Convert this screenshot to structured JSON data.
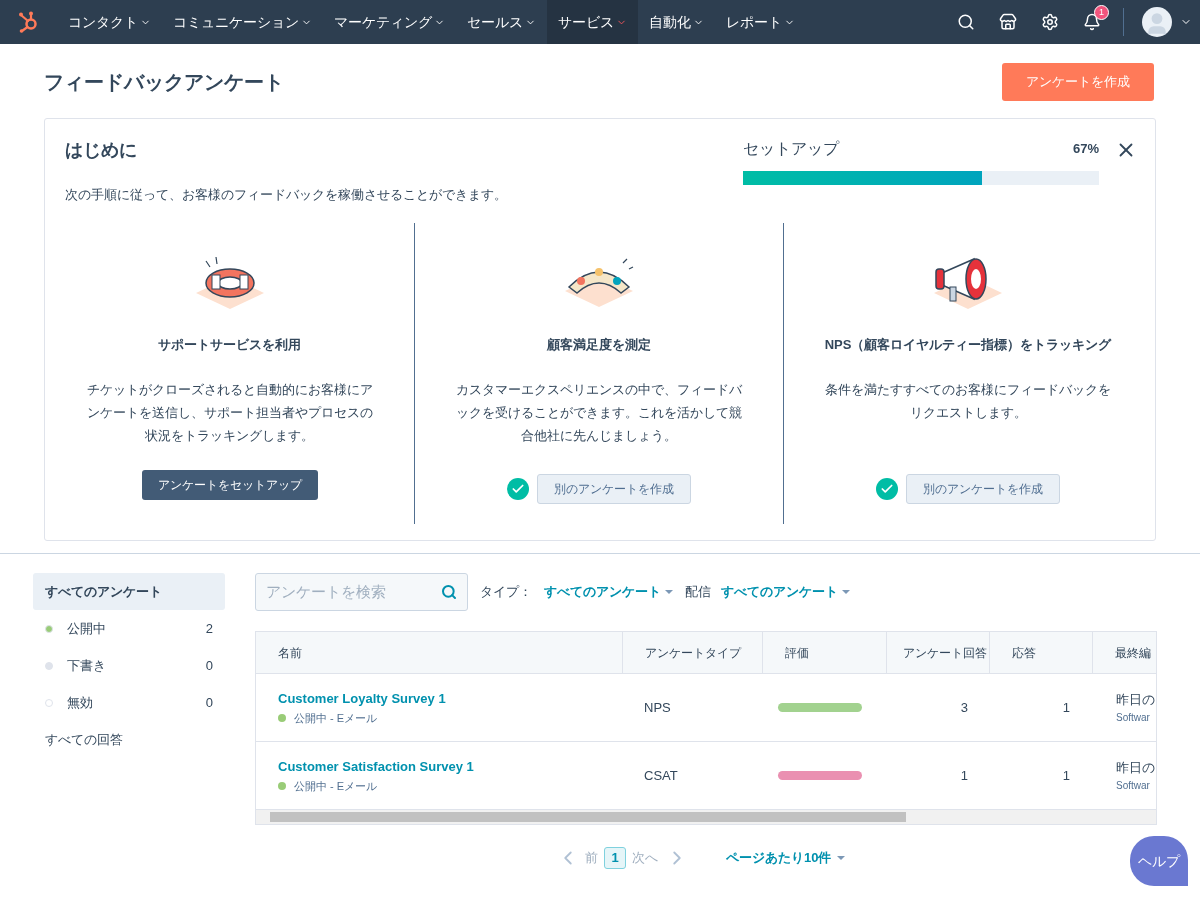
{
  "nav": {
    "items": [
      {
        "label": "コンタクト",
        "selected": false
      },
      {
        "label": "コミュニケーション",
        "selected": false
      },
      {
        "label": "マーケティング",
        "selected": false
      },
      {
        "label": "セールス",
        "selected": false
      },
      {
        "label": "サービス",
        "selected": true
      },
      {
        "label": "自動化",
        "selected": false
      },
      {
        "label": "レポート",
        "selected": false
      }
    ],
    "notification_count": "1"
  },
  "page": {
    "title": "フィードバックアンケート",
    "create_button": "アンケートを作成"
  },
  "onboarding": {
    "title": "はじめに",
    "description": "次の手順に従って、お客様のフィードバックを稼働させることができます。",
    "progress_label": "セットアップ",
    "progress_value": "67%",
    "level": 0.67,
    "steps": [
      {
        "kind": "lifebuoy",
        "title": "サポートサービスを利用",
        "text": "チケットがクローズされると自動的にお客様にアンケートを送信し、サポート担当者やプロセスの状況をトラッキングします。",
        "button": "アンケートをセットアップ",
        "done": false
      },
      {
        "kind": "meter",
        "title": "顧客満足度を測定",
        "text": "カスタマーエクスペリエンスの中で、フィードバックを受けることができます。これを活かして競合他社に先んじましょう。",
        "button": "別のアンケートを作成",
        "done": true
      },
      {
        "kind": "megaphone",
        "title": "NPS（顧客ロイヤルティー指標）をトラッキング",
        "text": "条件を満たすすべてのお客様にフィードバックをリクエストします。",
        "button": "別のアンケートを作成",
        "done": true
      }
    ]
  },
  "sidebar": {
    "items": [
      {
        "label": "すべてのアンケート",
        "selected": true
      },
      {
        "label": "公開中",
        "count": "2",
        "color": "#99cc77",
        "selected": false
      },
      {
        "label": "下書き",
        "count": "0",
        "color": "#dfe3eb",
        "selected": false
      },
      {
        "label": "無効",
        "count": "0",
        "color": "#ffffff",
        "selected": false
      },
      {
        "label": "すべての回答",
        "selected": false
      }
    ]
  },
  "filters": {
    "search_placeholder": "アンケートを検索",
    "type_label": "タイプ：",
    "type_value": "すべてのアンケート",
    "delivery_label": "配信",
    "delivery_value": "すべてのアンケート"
  },
  "table": {
    "columns": [
      "名前",
      "アンケートタイプ",
      "評価",
      "アンケート回答",
      "応答",
      "最終編"
    ],
    "rows": [
      {
        "name": "Customer Loyalty Survey 1",
        "status": {
          "text": "公開中 - Eメール",
          "color": "#99cc77"
        },
        "type": "NPS",
        "rating": {
          "color": "#a2d28f"
        },
        "responses": "3",
        "answers": "1",
        "edited": "昨日の",
        "edited_by": "Softwar"
      },
      {
        "name": "Customer Satisfaction Survey 1",
        "status": {
          "text": "公開中 - Eメール",
          "color": "#99cc77"
        },
        "type": "CSAT",
        "rating": {
          "color": "#ea90b1"
        },
        "responses": "1",
        "answers": "1",
        "edited": "昨日の",
        "edited_by": "Softwar"
      }
    ]
  },
  "pagination": {
    "prev": "前",
    "page": "1",
    "next": "次へ",
    "per_page": "ページあたり10件"
  },
  "help_button": "ヘルプ"
}
